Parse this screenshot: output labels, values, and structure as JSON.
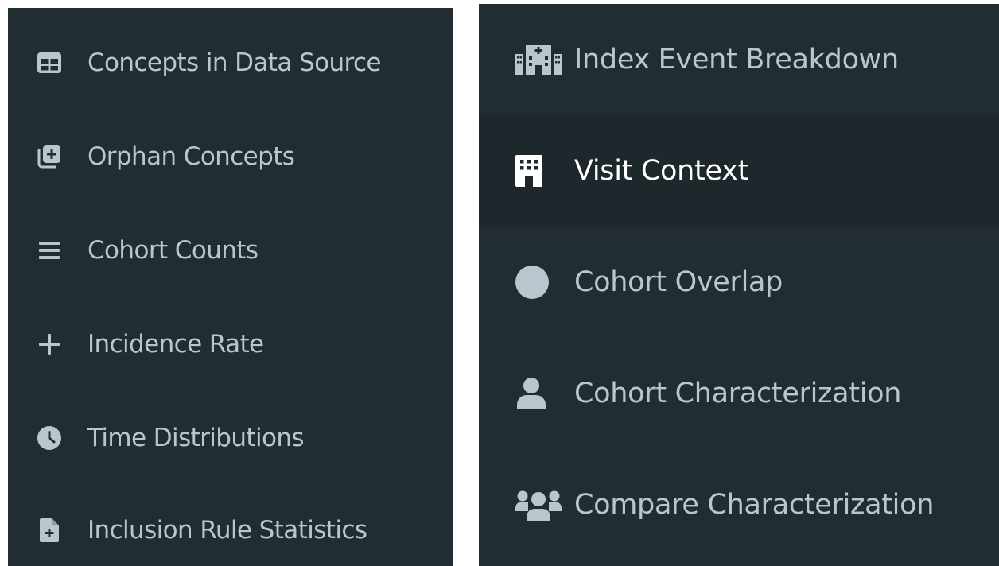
{
  "colors": {
    "sidebar_bg": "#222d32",
    "active_item_bg": "#1e282c",
    "item_text": "#b8c7ce",
    "active_item_text": "#ffffff"
  },
  "left_menu": {
    "items": [
      {
        "label": "Concepts in Data Source",
        "icon": "table-icon"
      },
      {
        "label": "Orphan Concepts",
        "icon": "copy-plus-icon"
      },
      {
        "label": "Cohort Counts",
        "icon": "bars-icon"
      },
      {
        "label": "Incidence Rate",
        "icon": "plus-icon"
      },
      {
        "label": "Time Distributions",
        "icon": "clock-icon"
      },
      {
        "label": "Inclusion Rule Statistics",
        "icon": "file-medical-icon"
      }
    ]
  },
  "right_menu": {
    "items": [
      {
        "label": "Index Event Breakdown",
        "icon": "hospital-buildings-icon",
        "active": false
      },
      {
        "label": "Visit Context",
        "icon": "hospital-icon",
        "active": true
      },
      {
        "label": "Cohort Overlap",
        "icon": "circle-icon",
        "active": false
      },
      {
        "label": "Cohort Characterization",
        "icon": "user-icon",
        "active": false
      },
      {
        "label": "Compare Characterization",
        "icon": "users-icon",
        "active": false
      }
    ]
  }
}
